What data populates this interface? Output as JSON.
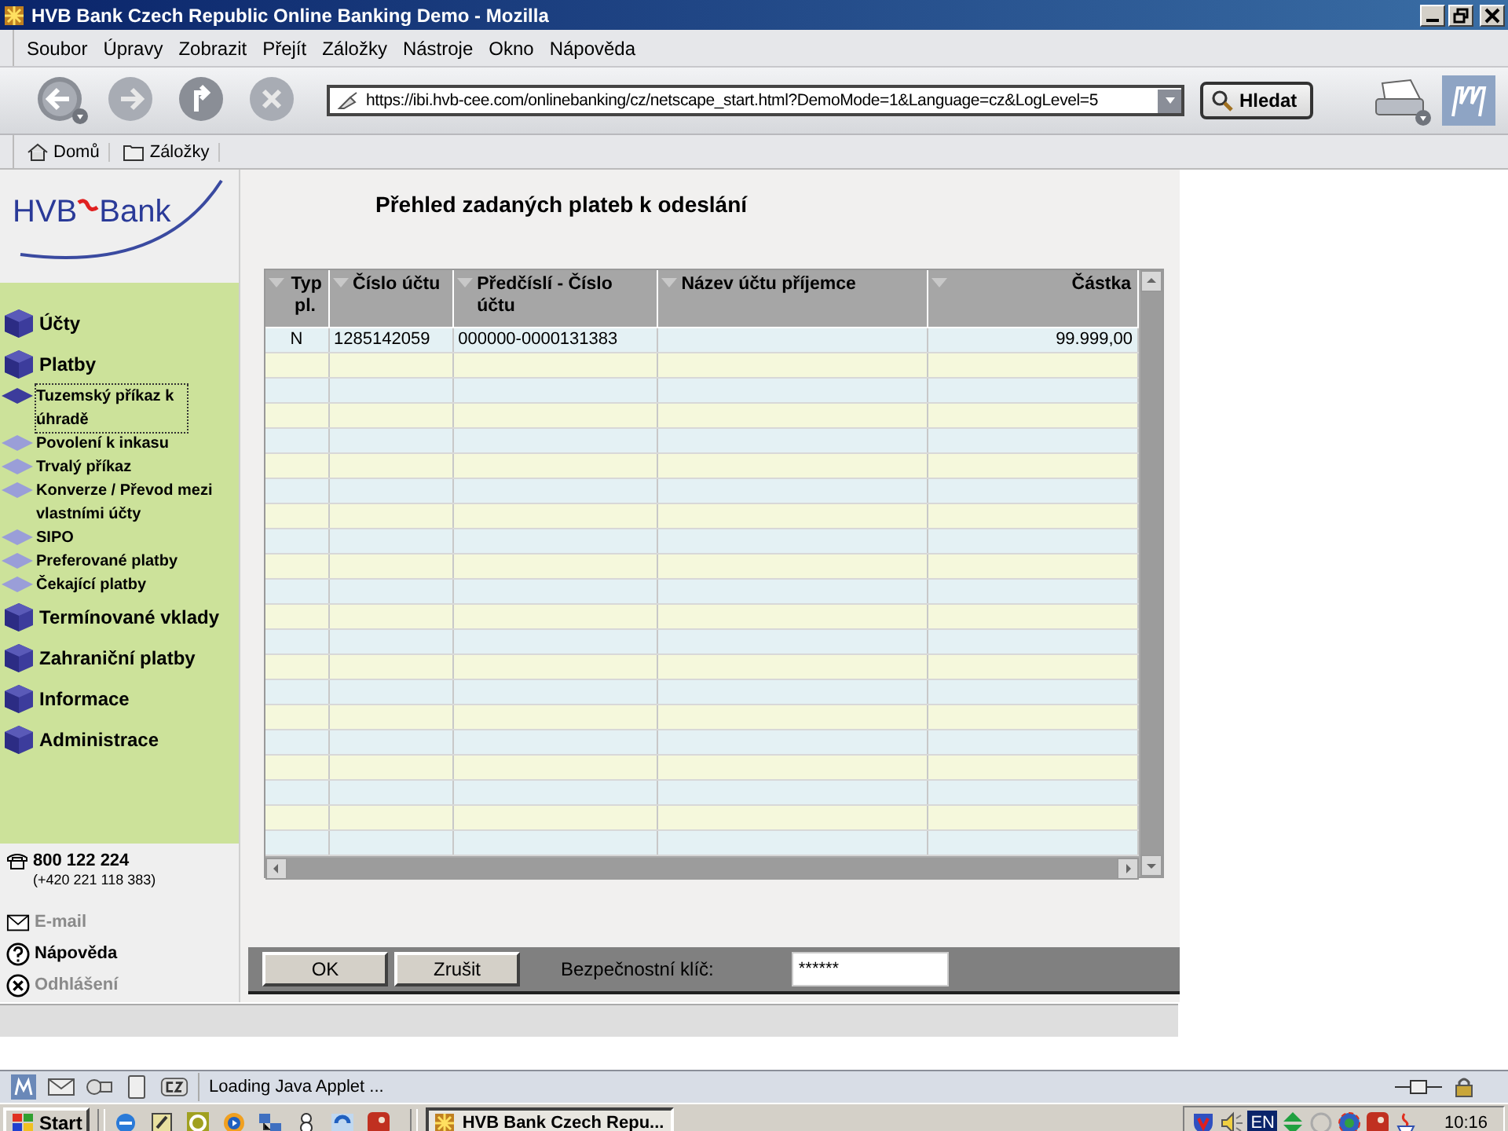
{
  "window": {
    "title": "HVB Bank Czech Republic Online Banking Demo - Mozilla"
  },
  "menu": [
    "Soubor",
    "Úpravy",
    "Zobrazit",
    "Přejít",
    "Záložky",
    "Nástroje",
    "Okno",
    "Nápověda"
  ],
  "navigation_toolbar": {
    "address": "https://ibi.hvb-cee.com/onlinebanking/cz/netscape_start.html?DemoMode=1&Language=cz&LogLevel=5",
    "search_button": "Hledat"
  },
  "personal_toolbar": [
    "Domů",
    "Záložky"
  ],
  "sidebar": {
    "logo": {
      "left": "HVB",
      "right": "Bank"
    },
    "items": [
      {
        "label": "Účty",
        "kind": "main",
        "selected": false
      },
      {
        "label": "Platby",
        "kind": "main",
        "selected": false
      },
      {
        "label": "Tuzemský příkaz k úhradě",
        "kind": "sub",
        "selected": true
      },
      {
        "label": "Povolení k inkasu",
        "kind": "sub",
        "selected": false
      },
      {
        "label": "Trvalý příkaz",
        "kind": "sub",
        "selected": false
      },
      {
        "label": "Konverze / Převod mezi vlastními účty",
        "kind": "sub",
        "selected": false
      },
      {
        "label": "SIPO",
        "kind": "sub",
        "selected": false
      },
      {
        "label": "Preferované platby",
        "kind": "sub",
        "selected": false
      },
      {
        "label": "Čekající platby",
        "kind": "sub",
        "selected": false
      },
      {
        "label": "Termínované vklady",
        "kind": "main",
        "selected": false
      },
      {
        "label": "Zahraniční platby",
        "kind": "main",
        "selected": false
      },
      {
        "label": "Informace",
        "kind": "main",
        "selected": false
      },
      {
        "label": "Administrace",
        "kind": "main",
        "selected": false
      }
    ],
    "phone": "800 122 224",
    "phone_alt": "(+420 221 118 383)",
    "links": [
      {
        "label": "E-mail",
        "kind": "mail",
        "disabled": true
      },
      {
        "label": "Nápověda",
        "kind": "help",
        "disabled": false
      },
      {
        "label": "Odhlášení",
        "kind": "logout",
        "disabled": true
      }
    ]
  },
  "page": {
    "heading": "Přehled zadaných plateb k odeslání",
    "table": {
      "columns": [
        "Typ pl.",
        "Číslo účtu",
        "Předčíslí - Číslo účtu",
        "Název účtu příjemce",
        "Částka"
      ],
      "rows": [
        [
          "N",
          "1285142059",
          "000000-0000131383",
          "",
          "99.999,00"
        ]
      ]
    },
    "buttons": [
      "OK",
      "Zrušit"
    ],
    "security_key": {
      "label": "Bezpečnostní klíč:",
      "value": "******"
    }
  },
  "status_bar": {
    "text": "Loading Java Applet ..."
  },
  "taskbar": {
    "start": "Start",
    "tasks": [
      {
        "label": "HVB Bank Czech Repu...",
        "selected": true
      }
    ],
    "language": "EN",
    "clock": "10:16"
  }
}
